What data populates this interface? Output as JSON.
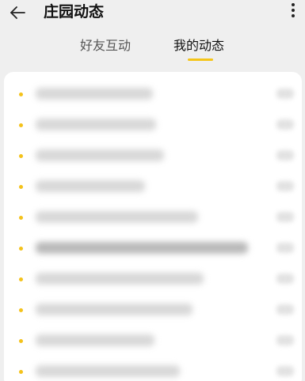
{
  "header": {
    "title": "庄园动态",
    "back_icon": "back-arrow-icon",
    "more_icon": "more-vertical-icon"
  },
  "tabs": [
    {
      "label": "好友互动",
      "active": false
    },
    {
      "label": "我的动态",
      "active": true
    }
  ],
  "colors": {
    "accent": "#f5c518",
    "background": "#efefef",
    "card": "#ffffff"
  },
  "feed": {
    "item_count": 10,
    "content_blurred": true
  }
}
